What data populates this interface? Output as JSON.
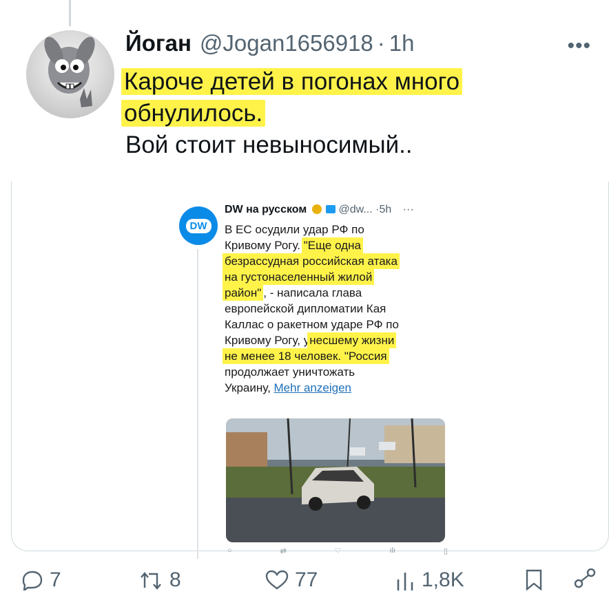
{
  "tweet": {
    "author_name": "Йоган",
    "author_handle": "@Jogan1656918",
    "time": "1h",
    "text_lines": [
      "Кароче детей в погонах много",
      "обнулилось.",
      "Вой стоит невыносимый.."
    ],
    "highlight_color": "#fff34a"
  },
  "quote": {
    "logo_text": "DW",
    "name": "DW на русском",
    "handle": "@dw...",
    "time": "5h",
    "text_lines": [
      "В ЕС осудили удар РФ по",
      "Кривому Рогу. ",
      "\"Еще одна",
      "безрассудная российская атака",
      "на густонаселенный жилой",
      "район\"",
      ", - написала глава",
      "европейской дипломатии Кая",
      "Каллас о ракетном ударе РФ по",
      "Кривому Рогу, у",
      "несшему жизни",
      "не менее 18 человек. \"Россия",
      "продолжает уничтожать",
      "Украину, ",
      "Mehr anzeigen"
    ],
    "logo_color": "#0b8be8"
  },
  "actions": {
    "replies": "7",
    "reposts": "8",
    "likes": "77",
    "views": "1,8K"
  }
}
